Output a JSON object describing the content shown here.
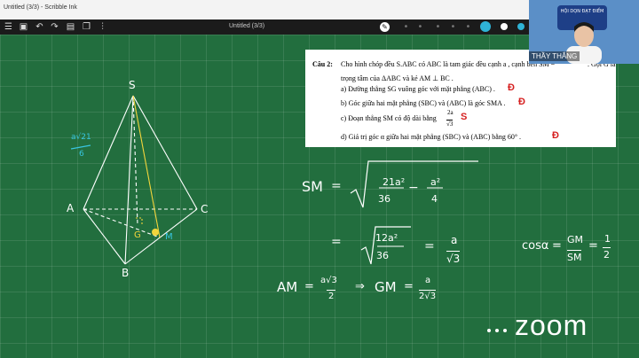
{
  "window": {
    "title": "Untitled (3/3) - Scribble Ink"
  },
  "toolbar": {
    "doc_title": "Untitled (3/3)"
  },
  "question": {
    "number": "Câu 2:",
    "line1": "Cho hình chóp đều  S.ABC có  ABC  là tam giác đều cạnh  a , cạnh bên SM =",
    "line1_tail": ". Gọi  G  là",
    "line2": "trọng tâm của  ΔABC  và kẻ  AM ⊥ BC .",
    "a": "a) Đường thẳng  SG  vuông góc với mặt phẳng  (ABC) .",
    "b": "b) Góc giữa hai mặt phẳng  (SBC)  và  (ABC)  là góc  SMA .",
    "c_prefix": "c) Đoạn thẳng  SM  có độ dài bằng",
    "c_frac_num": "2a",
    "c_frac_den": "√3",
    "d": "d) Giá trị góc  α  giữa hai mặt phẳng  (SBC)  và  (ABC)  bằng 60° .",
    "partial_den": "6",
    "mark_a": "Đ",
    "mark_b": "Đ",
    "mark_c": "S",
    "mark_d": "Đ"
  },
  "figure": {
    "S": "S",
    "A": "A",
    "B": "B",
    "C": "C",
    "G": "G",
    "M": "M",
    "edge_num": "a√21",
    "edge_den": "6"
  },
  "work": {
    "sm_label": "SM",
    "eq": "=",
    "t1_num": "21a²",
    "t1_den": "36",
    "minus": "−",
    "t2_num": "a²",
    "t2_den": "4",
    "r_num": "12a²",
    "r_den": "36",
    "res_num": "a",
    "res_den": "√3",
    "cos_label": "cosα",
    "gm": "GM",
    "sm": "SM",
    "half_num": "1",
    "half_den": "2",
    "am_label": "AM",
    "am_num": "a√3",
    "am_den": "2",
    "arrow": "⇒",
    "gm_label": "GM",
    "gm_num": "a",
    "gm_den": "2√3"
  },
  "webcam": {
    "name": "THẦY THẮNG",
    "banner": "HỘI DỌN ĐẠT ĐIỂM"
  },
  "app": {
    "zoom_logo": "zoom"
  },
  "colors": {
    "board": "#226e3e",
    "chalk": "#ffffff",
    "accent": "#2fb3d6",
    "mark": "#d62020"
  }
}
